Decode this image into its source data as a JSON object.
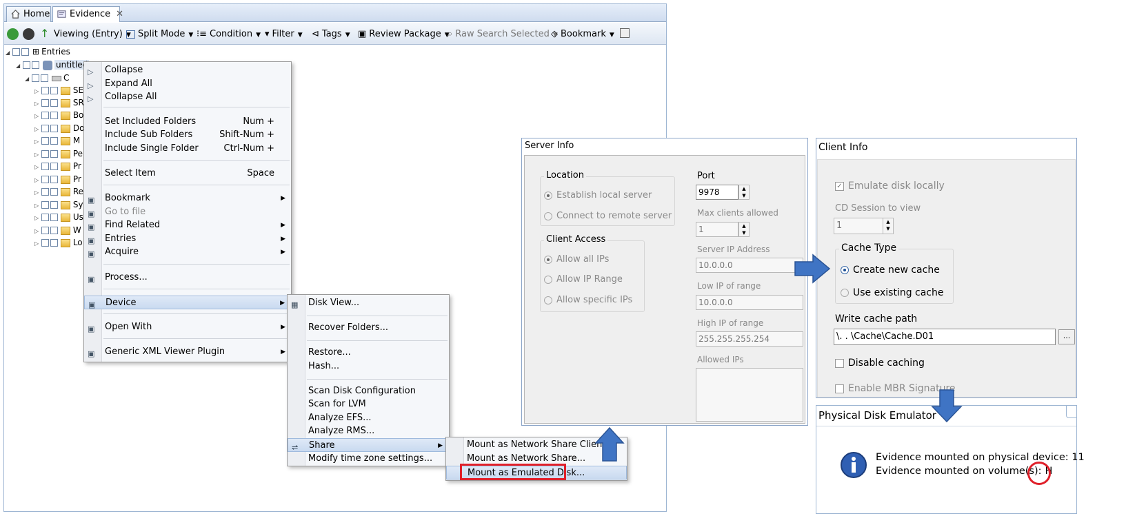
{
  "tabs": [
    {
      "label": "Home",
      "icon": "home-icon"
    },
    {
      "label": "Evidence",
      "icon": "evidence-icon",
      "close": "✕"
    }
  ],
  "toolbar": {
    "viewing": "Viewing (Entry)",
    "split_mode": "Split Mode",
    "condition": "Condition",
    "filter": "Filter",
    "tags": "Tags",
    "review_package": "Review Package",
    "raw_search": "Raw Search Selected",
    "bookmark": "Bookmark"
  },
  "tree": {
    "root": "Entries",
    "device": "untitled",
    "volume": "C",
    "children": [
      "SE",
      "SR",
      "Bo",
      "Do",
      "M",
      "Pe",
      "Pr",
      "Pr",
      "Re",
      "Sy",
      "Us",
      "W",
      "Lo"
    ]
  },
  "context_menu": {
    "items": [
      {
        "label": "Collapse",
        "shortcut": "",
        "submenu": false,
        "disabled": false
      },
      {
        "label": "Expand All",
        "shortcut": "",
        "submenu": false,
        "disabled": false
      },
      {
        "label": "Collapse All",
        "shortcut": "",
        "submenu": false,
        "disabled": false
      },
      {
        "label": "Set Included Folders",
        "shortcut": "Num +",
        "submenu": false,
        "disabled": false
      },
      {
        "label": "Include Sub Folders",
        "shortcut": "Shift-Num +",
        "submenu": false,
        "disabled": false
      },
      {
        "label": "Include Single Folder",
        "shortcut": "Ctrl-Num +",
        "submenu": false,
        "disabled": false
      },
      {
        "label": "Select Item",
        "shortcut": "Space",
        "submenu": false,
        "disabled": false
      },
      {
        "label": "Bookmark",
        "shortcut": "",
        "submenu": true,
        "disabled": false
      },
      {
        "label": "Go to file",
        "shortcut": "",
        "submenu": false,
        "disabled": true
      },
      {
        "label": "Find Related",
        "shortcut": "",
        "submenu": true,
        "disabled": false
      },
      {
        "label": "Entries",
        "shortcut": "",
        "submenu": true,
        "disabled": false
      },
      {
        "label": "Acquire",
        "shortcut": "",
        "submenu": true,
        "disabled": false
      },
      {
        "label": "Process...",
        "shortcut": "",
        "submenu": false,
        "disabled": false
      },
      {
        "label": "Device",
        "shortcut": "",
        "submenu": true,
        "disabled": false
      },
      {
        "label": "Open With",
        "shortcut": "",
        "submenu": true,
        "disabled": false
      },
      {
        "label": "Generic XML Viewer Plugin",
        "shortcut": "",
        "submenu": true,
        "disabled": false
      }
    ]
  },
  "device_menu": {
    "items": [
      {
        "label": "Disk View...",
        "submenu": false
      },
      {
        "label": "Recover Folders...",
        "submenu": false
      },
      {
        "label": "Restore...",
        "submenu": false
      },
      {
        "label": "Hash...",
        "submenu": false
      },
      {
        "label": "Scan Disk Configuration",
        "submenu": false
      },
      {
        "label": "Scan for LVM",
        "submenu": false
      },
      {
        "label": "Analyze EFS...",
        "submenu": false
      },
      {
        "label": "Analyze RMS...",
        "submenu": false
      },
      {
        "label": "Share",
        "submenu": true
      },
      {
        "label": "Modify time zone settings...",
        "submenu": false
      }
    ]
  },
  "share_menu": {
    "items": [
      {
        "label": "Mount as Network Share Client..."
      },
      {
        "label": "Mount as Network Share..."
      },
      {
        "label": "Mount as Emulated Disk..."
      }
    ]
  },
  "server_info": {
    "title": "Server Info",
    "location": {
      "title": "Location",
      "opt1": "Establish local server",
      "opt2": "Connect to remote server"
    },
    "client_access": {
      "title": "Client Access",
      "opt1": "Allow all IPs",
      "opt2": "Allow IP Range",
      "opt3": "Allow specific IPs"
    },
    "port_label": "Port",
    "port_value": "9978",
    "max_clients_label": "Max clients allowed",
    "max_clients_value": "1",
    "server_ip_label": "Server IP Address",
    "server_ip_value": "10.0.0.0",
    "low_ip_label": "Low IP of range",
    "low_ip_value": "10.0.0.0",
    "high_ip_label": "High IP of range",
    "high_ip_value": "255.255.255.254",
    "allowed_ips_label": "Allowed IPs"
  },
  "client_info": {
    "title": "Client Info",
    "emulate": "Emulate disk locally",
    "cd_session_label": "CD Session to view",
    "cd_session_value": "1",
    "cache_type_title": "Cache Type",
    "cache_opt1": "Create new cache",
    "cache_opt2": "Use existing cache",
    "write_cache_label": "Write cache path",
    "write_cache_value": "\\.           .              \\Cache\\Cache.D01",
    "browse": "...",
    "disable_caching": "Disable caching",
    "enable_mbr": "Enable MBR Signature"
  },
  "emulator": {
    "title": "Physical Disk Emulator",
    "line1": "Evidence mounted on physical device: 11",
    "line2_prefix": "Evidence mounted on volume(s):",
    "volume": "H"
  },
  "colors": {
    "accent_arrow": "#3f74c4",
    "highlight_red": "#e0202a",
    "window_border": "#9eb6d3"
  }
}
